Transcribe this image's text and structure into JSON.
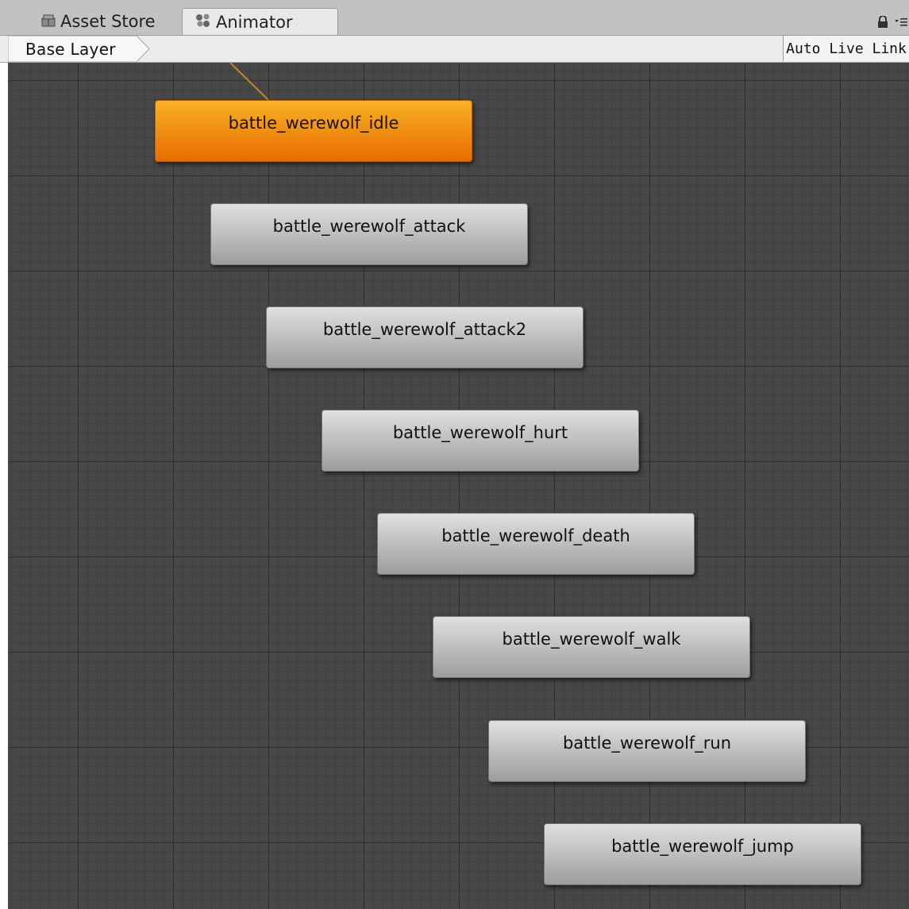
{
  "tabs": [
    {
      "label": "Asset Store",
      "icon": "asset-store-icon"
    },
    {
      "label": "Animator",
      "icon": "animator-icon"
    }
  ],
  "toolbar": {
    "breadcrumb": "Base Layer",
    "auto_live_link": "Auto Live Link",
    "lock_icon": "lock-icon",
    "menu_icon": "panel-menu-icon"
  },
  "colors": {
    "default_state": "#f09018",
    "state": "#c2c2c2",
    "grid": "#474747"
  },
  "states": [
    {
      "label": "battle_werewolf_idle",
      "default": true
    },
    {
      "label": "battle_werewolf_attack",
      "default": false
    },
    {
      "label": "battle_werewolf_attack2",
      "default": false
    },
    {
      "label": "battle_werewolf_hurt",
      "default": false
    },
    {
      "label": "battle_werewolf_death",
      "default": false
    },
    {
      "label": "battle_werewolf_walk",
      "default": false
    },
    {
      "label": "battle_werewolf_run",
      "default": false
    },
    {
      "label": "battle_werewolf_jump",
      "default": false
    }
  ]
}
